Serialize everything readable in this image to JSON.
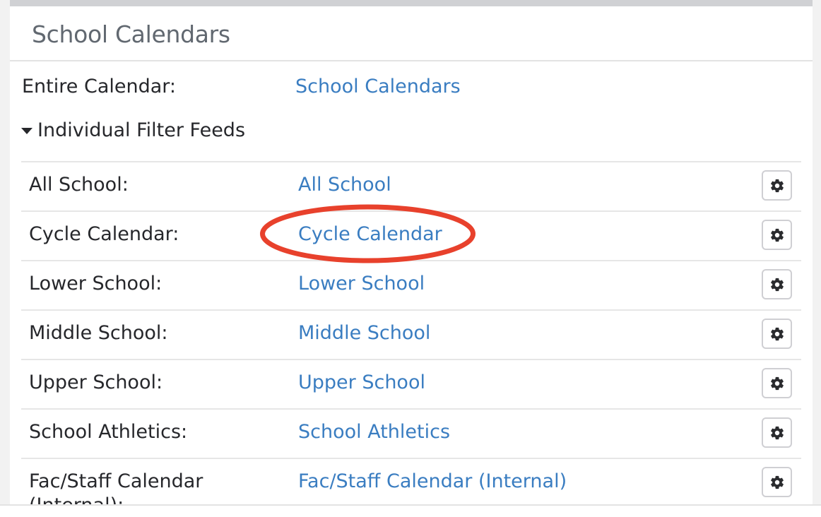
{
  "panel": {
    "title": "School Calendars"
  },
  "entire_calendar": {
    "label": "Entire Calendar:",
    "link": "School Calendars"
  },
  "feeds_section": {
    "toggle_label": "Individual Filter Feeds",
    "expanded": true,
    "rows": [
      {
        "label": "All School:",
        "link": "All School",
        "action_icon": "gear-icon"
      },
      {
        "label": "Cycle Calendar:",
        "link": "Cycle Calendar",
        "action_icon": "gear-icon",
        "highlighted": true
      },
      {
        "label": "Lower School:",
        "link": "Lower School",
        "action_icon": "gear-icon"
      },
      {
        "label": "Middle School:",
        "link": "Middle School",
        "action_icon": "gear-icon"
      },
      {
        "label": "Upper School:",
        "link": "Upper School",
        "action_icon": "gear-icon"
      },
      {
        "label": "School Athletics:",
        "link": "School Athletics",
        "action_icon": "gear-icon"
      },
      {
        "label": "Fac/Staff Calendar (Internal):",
        "link": "Fac/Staff Calendar (Internal)",
        "action_icon": "gear-icon"
      }
    ]
  },
  "annotation": {
    "type": "red-ellipse",
    "target": "Cycle Calendar",
    "color": "#e8412c"
  },
  "colors": {
    "link": "#3a7dc1",
    "text": "#26272b",
    "title": "#616870"
  }
}
